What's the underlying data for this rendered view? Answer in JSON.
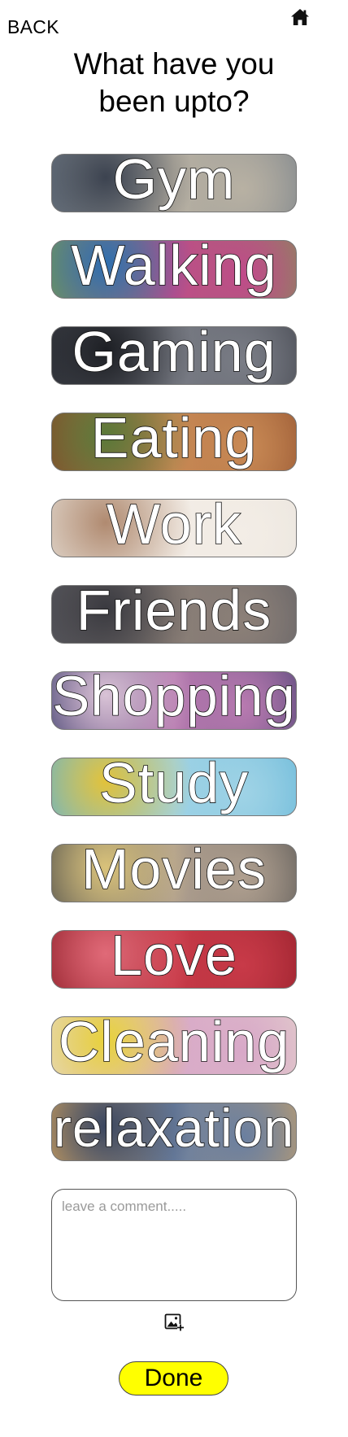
{
  "header": {
    "back_label": "BACK",
    "home_icon": "home-icon"
  },
  "page": {
    "title": "What have you\n been upto?"
  },
  "activities": [
    {
      "label": "Gym",
      "bg": "#6f7a86",
      "bg2": "#b8b1a3",
      "accent": "#3c4350"
    },
    {
      "label": "Walking",
      "bg": "#7b9a4e",
      "bg2": "#c04a8a",
      "accent": "#2f6fb0"
    },
    {
      "label": "Gaming",
      "bg": "#3a3d45",
      "bg2": "#7a7d86",
      "accent": "#1d1f24"
    },
    {
      "label": "Eating",
      "bg": "#8b4a2a",
      "bg2": "#c98a55",
      "accent": "#5a7a3a"
    },
    {
      "label": "Work",
      "bg": "#e9e4dc",
      "bg2": "#f3ede6",
      "accent": "#b08a70"
    },
    {
      "label": "Friends",
      "bg": "#5c5c62",
      "bg2": "#8c8078",
      "accent": "#3a3a40"
    },
    {
      "label": "Shopping",
      "bg": "#3a3a6a",
      "bg2": "#b87ab0",
      "accent": "#d9c3d6"
    },
    {
      "label": "Study",
      "bg": "#5fb3d6",
      "bg2": "#9fd3e6",
      "accent": "#e2c23a"
    },
    {
      "label": "Movies",
      "bg": "#4a4a4a",
      "bg2": "#b0a090",
      "accent": "#d9c27a"
    },
    {
      "label": "Love",
      "bg": "#8a1a24",
      "bg2": "#c83a48",
      "accent": "#e06a78"
    },
    {
      "label": "Cleaning",
      "bg": "#e6d8cc",
      "bg2": "#d8a8c8",
      "accent": "#e8d23a"
    },
    {
      "label": "relaxation",
      "bg": "#d9a860",
      "bg2": "#6a7fa0",
      "accent": "#3a4660"
    }
  ],
  "comment": {
    "placeholder": "leave a comment....."
  },
  "attach": {
    "icon": "add-image-icon"
  },
  "done_label": "Done",
  "colors": {
    "done_button": "#ffff00",
    "border": "#777777"
  }
}
